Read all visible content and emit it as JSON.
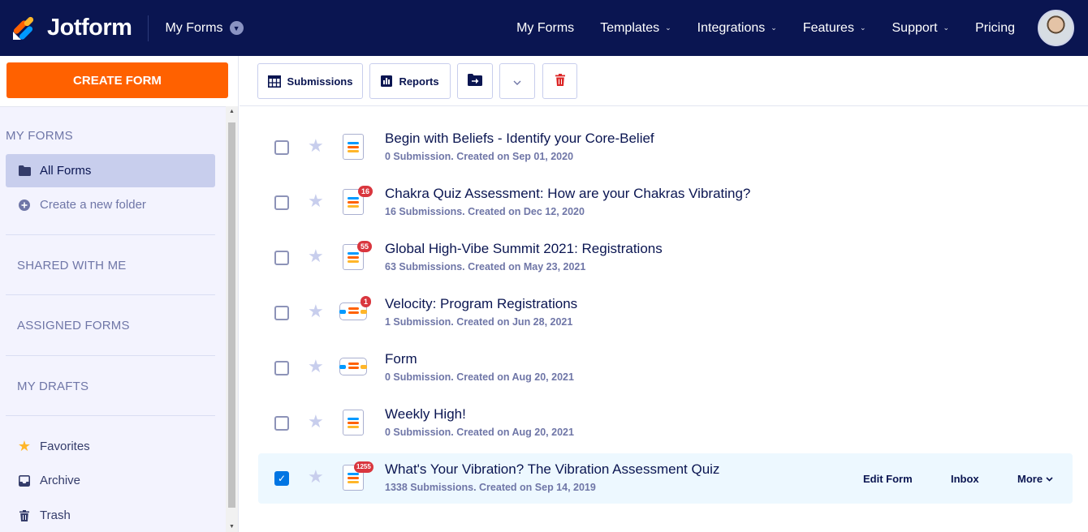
{
  "header": {
    "brand": "Jotform",
    "forms_dropdown": "My Forms",
    "nav": [
      {
        "label": "My Forms",
        "has_chevron": false
      },
      {
        "label": "Templates",
        "has_chevron": true
      },
      {
        "label": "Integrations",
        "has_chevron": true
      },
      {
        "label": "Features",
        "has_chevron": true
      },
      {
        "label": "Support",
        "has_chevron": true
      },
      {
        "label": "Pricing",
        "has_chevron": false
      }
    ]
  },
  "sidebar": {
    "create_label": "CREATE FORM",
    "my_forms_title": "MY FORMS",
    "all_forms": "All Forms",
    "create_folder": "Create a new folder",
    "shared": "SHARED WITH ME",
    "assigned": "ASSIGNED FORMS",
    "drafts": "MY DRAFTS",
    "favorites": "Favorites",
    "archive": "Archive",
    "trash": "Trash"
  },
  "toolbar": {
    "submissions": "Submissions",
    "reports": "Reports"
  },
  "forms": [
    {
      "title": "Begin with Beliefs - Identify your Core-Belief",
      "meta": "0 Submission. Created on Sep 01, 2020",
      "badge": "",
      "icon": "classic-form-icon",
      "checked": false
    },
    {
      "title": "Chakra Quiz Assessment: How are your Chakras Vibrating?",
      "meta": "16 Submissions. Created on Dec 12, 2020",
      "badge": "16",
      "icon": "classic-form-icon",
      "checked": false
    },
    {
      "title": "Global High-Vibe Summit 2021: Registrations",
      "meta": "63 Submissions. Created on May 23, 2021",
      "badge": "55",
      "icon": "classic-form-icon",
      "checked": false
    },
    {
      "title": "Velocity: Program Registrations",
      "meta": "1 Submission. Created on Jun 28, 2021",
      "badge": "1",
      "icon": "card-form-icon",
      "checked": false
    },
    {
      "title": "Form",
      "meta": "0 Submission. Created on Aug 20, 2021",
      "badge": "",
      "icon": "card-form-icon",
      "checked": false
    },
    {
      "title": "Weekly High!",
      "meta": "0 Submission. Created on Aug 20, 2021",
      "badge": "",
      "icon": "classic-form-icon",
      "checked": false
    },
    {
      "title": "What's Your Vibration? The Vibration Assessment Quiz",
      "meta": "1338 Submissions. Created on Sep 14, 2019",
      "badge": "1255",
      "icon": "classic-form-icon",
      "checked": true
    }
  ],
  "row_actions": {
    "edit": "Edit Form",
    "inbox": "Inbox",
    "more": "More"
  },
  "colors": {
    "navy": "#0a1551",
    "orange": "#ff6100",
    "badge_red": "#d9363e",
    "checkbox_blue": "#0075e3"
  }
}
